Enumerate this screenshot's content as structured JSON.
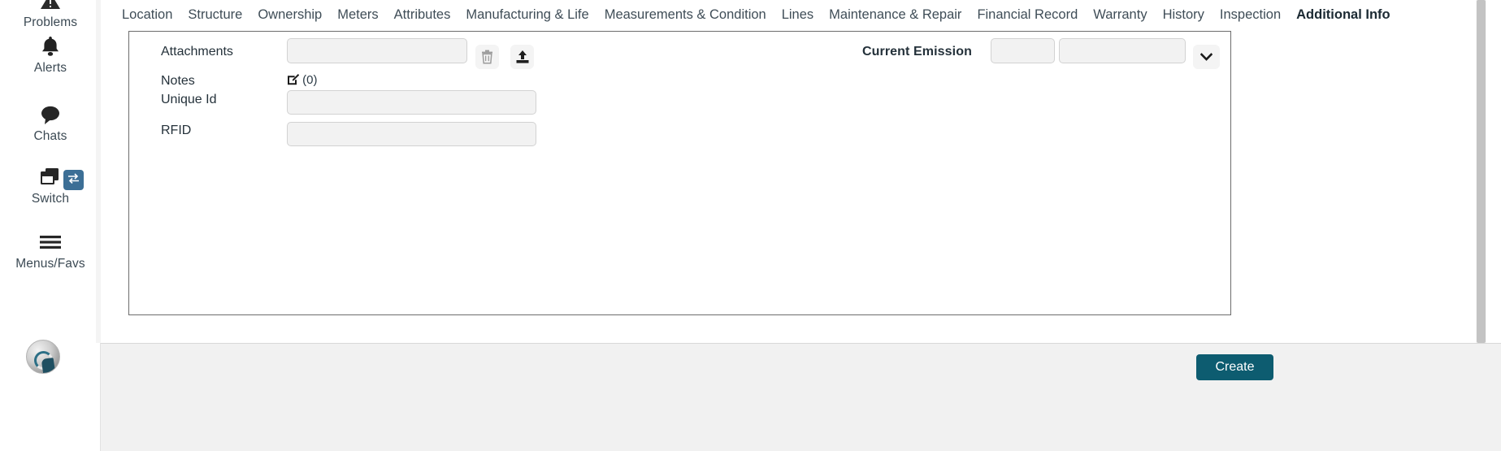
{
  "rail": {
    "items": [
      {
        "id": "problems",
        "label": "Problems",
        "icon": "warning-icon"
      },
      {
        "id": "alerts",
        "label": "Alerts",
        "icon": "bell-icon"
      },
      {
        "id": "chats",
        "label": "Chats",
        "icon": "chat-bubble-icon"
      },
      {
        "id": "switch",
        "label": "Switch",
        "icon": "windows-stack-icon",
        "badge_icon": "swap-arrows-icon"
      },
      {
        "id": "menus",
        "label": "Menus/Favs",
        "icon": "hamburger-icon"
      }
    ],
    "avatar_name": "user-avatar"
  },
  "tabs": [
    {
      "label": "Location",
      "active": false
    },
    {
      "label": "Structure",
      "active": false
    },
    {
      "label": "Ownership",
      "active": false
    },
    {
      "label": "Meters",
      "active": false
    },
    {
      "label": "Attributes",
      "active": false
    },
    {
      "label": "Manufacturing & Life",
      "active": false
    },
    {
      "label": "Measurements & Condition",
      "active": false
    },
    {
      "label": "Lines",
      "active": false
    },
    {
      "label": "Maintenance & Repair",
      "active": false
    },
    {
      "label": "Financial Record",
      "active": false
    },
    {
      "label": "Warranty",
      "active": false
    },
    {
      "label": "History",
      "active": false
    },
    {
      "label": "Inspection",
      "active": false
    },
    {
      "label": "Additional Info",
      "active": true
    }
  ],
  "form": {
    "attachments": {
      "label": "Attachments",
      "value": "",
      "placeholder": "",
      "delete_icon": "trash-icon",
      "upload_icon": "upload-icon"
    },
    "notes": {
      "label": "Notes",
      "count_text": "(0)",
      "edit_icon": "edit-note-icon"
    },
    "unique_id": {
      "label": "Unique Id",
      "value": "",
      "placeholder": ""
    },
    "rfid": {
      "label": "RFID",
      "value": "",
      "placeholder": ""
    },
    "current_emission": {
      "label": "Current Emission",
      "value_a": "",
      "value_b": "",
      "placeholder_a": "",
      "placeholder_b": "",
      "expand_icon": "chevron-down-icon"
    }
  },
  "footer": {
    "create_label": "Create"
  },
  "colors": {
    "accent_teal": "#0d5c70",
    "active_tab_underline": "#0d5e71",
    "switch_badge_blue": "#3c6f96",
    "panel_border": "#6d6d6d",
    "input_bg": "#f2f2f2",
    "footer_bg": "#f1f1f1"
  }
}
